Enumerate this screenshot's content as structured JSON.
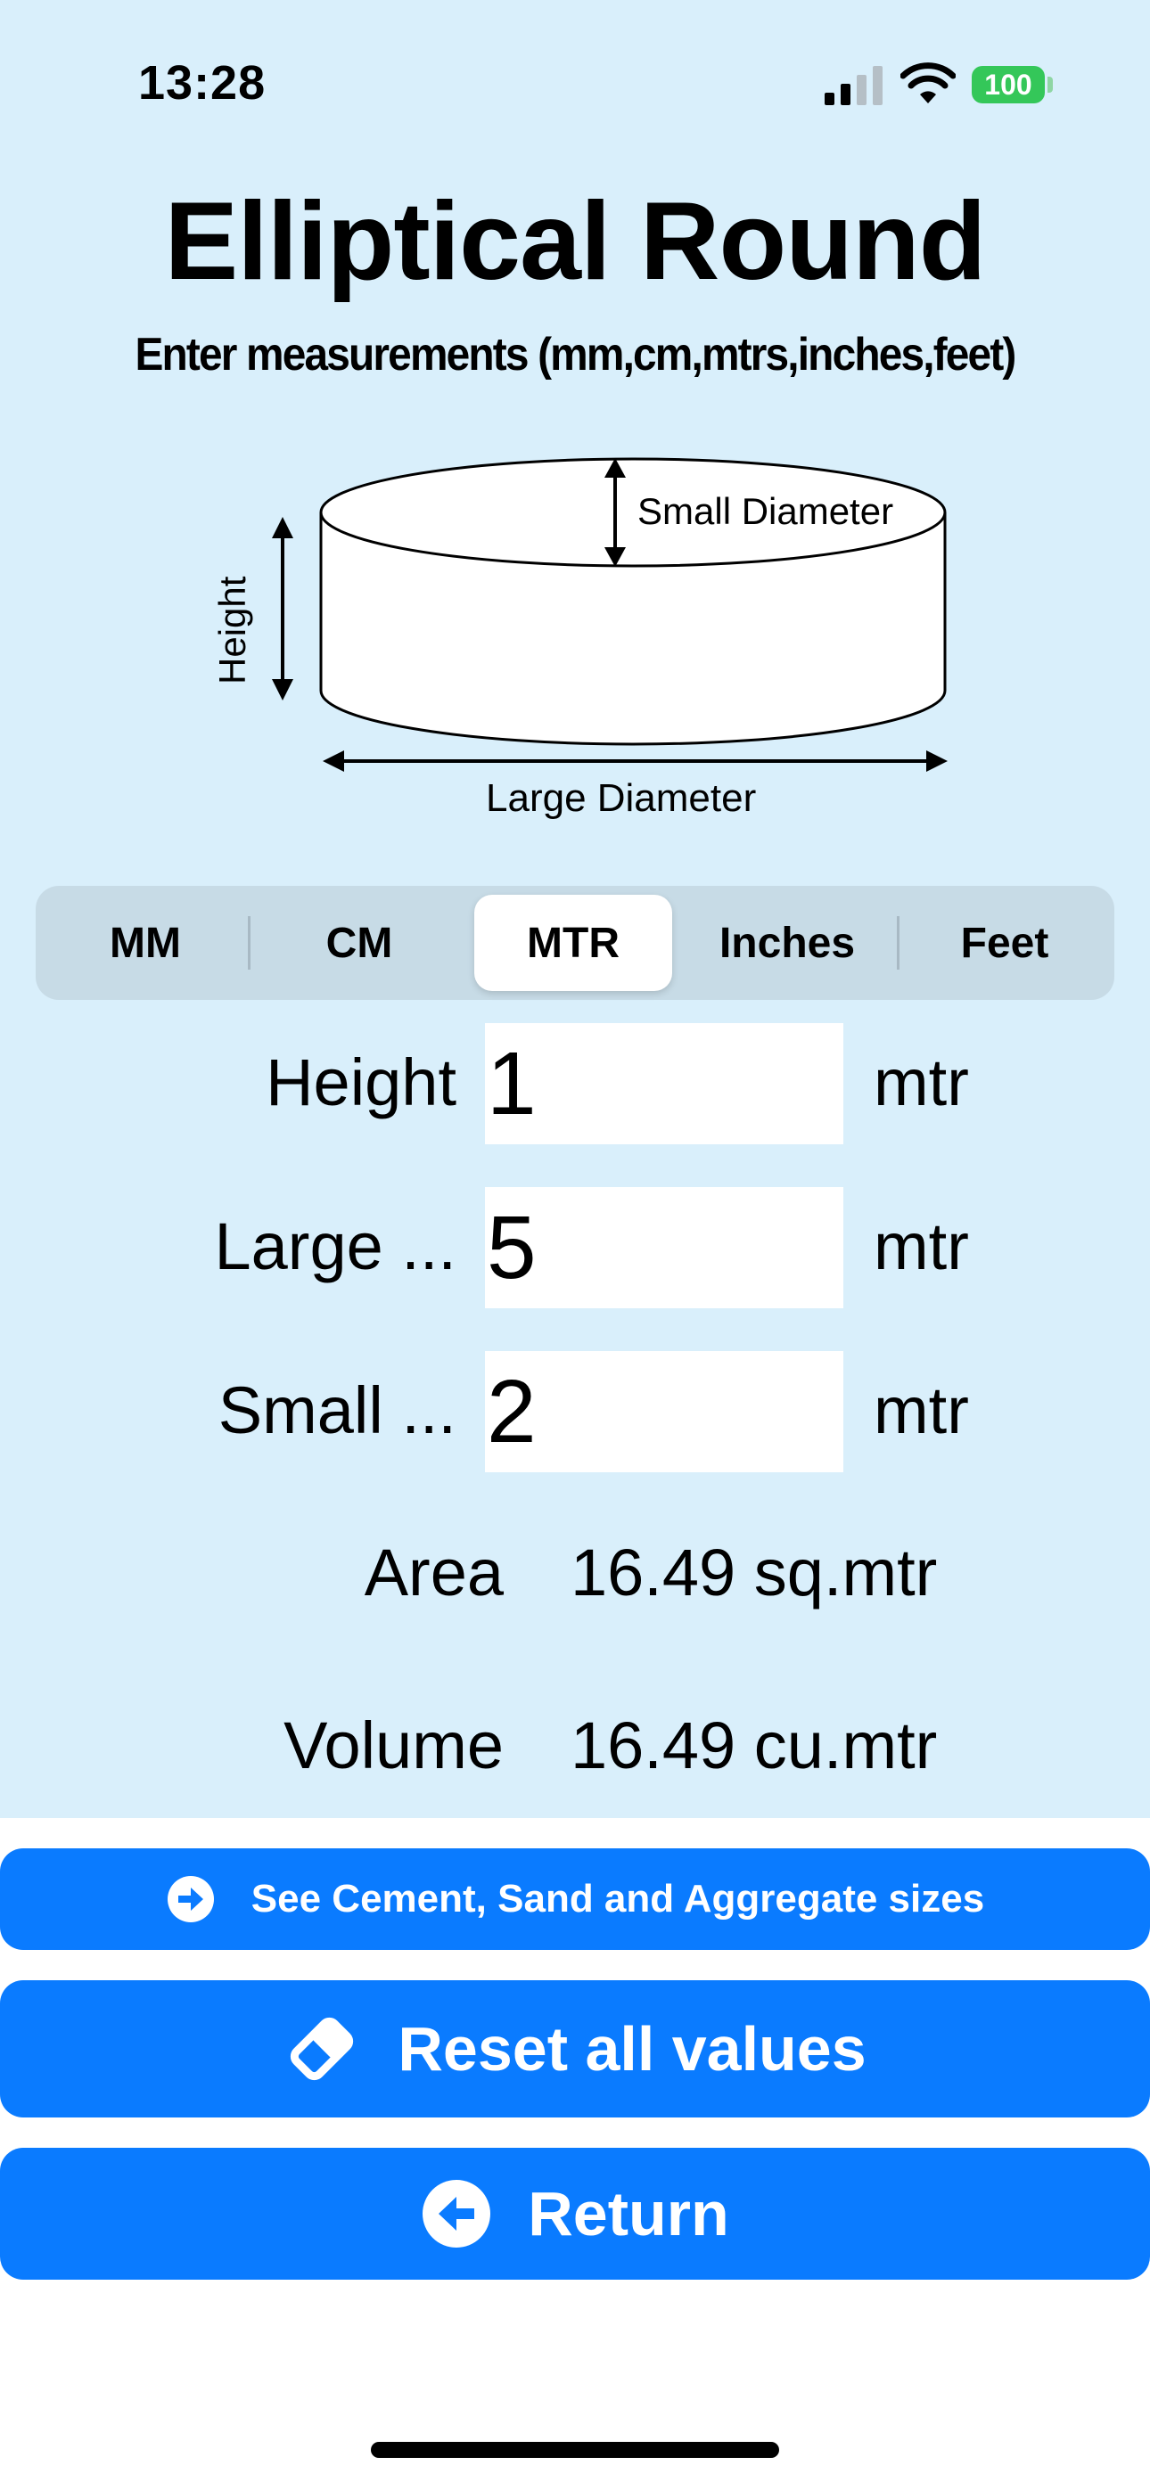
{
  "status_bar": {
    "time": "13:28",
    "battery": "100"
  },
  "title": "Elliptical Round",
  "subtitle": "Enter measurements (mm,cm,mtrs,inches,feet)",
  "diagram": {
    "small_diameter_label": "Small Diameter",
    "height_label": "Height",
    "large_diameter_label": "Large Diameter"
  },
  "units_segmented": {
    "options": [
      "MM",
      "CM",
      "MTR",
      "Inches",
      "Feet"
    ],
    "selected": "MTR"
  },
  "fields": [
    {
      "label": "Height",
      "value": "1",
      "unit": "mtr"
    },
    {
      "label": "Large ...",
      "value": "5",
      "unit": "mtr"
    },
    {
      "label": "Small ...",
      "value": "2",
      "unit": "mtr"
    }
  ],
  "results": {
    "area_label": "Area",
    "area_value": "16.49 sq.mtr",
    "volume_label": "Volume",
    "volume_value": "16.49 cu.mtr"
  },
  "buttons": {
    "materials": "See Cement, Sand and Aggregate sizes",
    "reset": "Reset all values",
    "return": "Return"
  },
  "colors": {
    "background": "#d9effb",
    "button": "#0a7bff",
    "battery": "#34c759"
  }
}
